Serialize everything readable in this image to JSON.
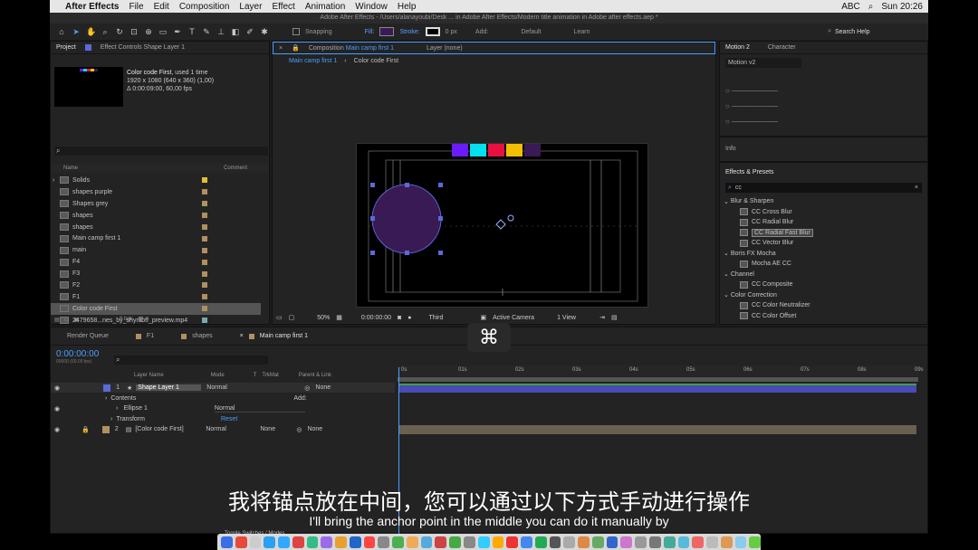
{
  "menubar": {
    "app": "After Effects",
    "items": [
      "File",
      "Edit",
      "Composition",
      "Layer",
      "Effect",
      "Animation",
      "Window",
      "Help"
    ],
    "abc": "ABC",
    "time": "Sun 20:26"
  },
  "titlebar": "Adobe After Effects - /Users/alanayoubi/Desk ... in Adobe After Effects/Modern title animation in Adobe after effects.aep *",
  "toolbar": {
    "snapping": "Snapping",
    "fill": "Fill:",
    "stroke": "Stroke:",
    "stroke_px": "0 px",
    "add": "Add:",
    "workspace1": "Default",
    "workspace2": "Learn",
    "search": "Search Help"
  },
  "project": {
    "tab1": "Project",
    "tab2": "Effect Controls Shape Layer 1",
    "name": "Color code First",
    "used": ", used 1 time",
    "info1": "1920 x 1080  (640 x 360) (1,00)",
    "info2": "Δ 0:00:09:00, 60,00 fps",
    "col_name": "Name",
    "col_comment": "Comment",
    "bpc": "8 bpc",
    "items": [
      {
        "name": "Solids",
        "color": "#e0c030",
        "folder": true
      },
      {
        "name": "shapes purple",
        "color": "#b09060"
      },
      {
        "name": "Shapes grey",
        "color": "#b09060"
      },
      {
        "name": "shapes",
        "color": "#b09060"
      },
      {
        "name": "shapes",
        "color": "#b09060"
      },
      {
        "name": "Main camp first 1",
        "color": "#b09060"
      },
      {
        "name": "main",
        "color": "#b09060"
      },
      {
        "name": "F4",
        "color": "#b09060"
      },
      {
        "name": "F3",
        "color": "#b09060"
      },
      {
        "name": "F2",
        "color": "#b09060"
      },
      {
        "name": "F1",
        "color": "#b09060"
      },
      {
        "name": "Color code First",
        "color": "#b09060",
        "selected": true
      },
      {
        "name": "2479658...nes_by_shymoff_preview.mp4",
        "color": "#7aaab0"
      }
    ]
  },
  "comp": {
    "tab": "Composition",
    "tab_name": "Main camp first 1",
    "layer_tab": "Layer (none)",
    "crumb1": "Main camp first 1",
    "crumb2": "Color code First",
    "zoom": "50%",
    "timecode": "0:00:00:00",
    "res": "Third",
    "camera": "Active Camera",
    "views": "1 View",
    "swatches": [
      "#6a1bff",
      "#00e0ee",
      "#e81040",
      "#f0c000",
      "#3a1a55"
    ]
  },
  "right": {
    "tab1": "Motion 2",
    "tab2": "Character",
    "preset": "Motion v2",
    "info": "Info",
    "effects_title": "Effects & Presets",
    "search": "cc",
    "groups": [
      {
        "name": "Blur & Sharpen",
        "items": [
          "CC Cross Blur",
          "CC Radial Blur",
          "CC Radial Fast Blur",
          "CC Vector Blur"
        ]
      },
      {
        "name": "Boris FX Mocha",
        "items": [
          "Mocha AE CC"
        ]
      },
      {
        "name": "Channel",
        "items": [
          "CC Composite"
        ]
      },
      {
        "name": "Color Correction",
        "items": [
          "CC Color Neutralizer",
          "CC Color Offset"
        ]
      }
    ],
    "selected_effect": "CC Radial Fast Blur"
  },
  "timeline": {
    "tabs": [
      {
        "label": "Render Queue"
      },
      {
        "label": "F1",
        "color": "#b09060"
      },
      {
        "label": "shapes",
        "color": "#b09060"
      },
      {
        "label": "Main camp first 1",
        "color": "#b09060",
        "active": true
      }
    ],
    "timecode": "0:00:00:00",
    "fps": "00000 (60.00 fps)",
    "col_layer": "Layer Name",
    "col_mode": "Mode",
    "col_t": "T",
    "col_trkmat": "TrkMat",
    "col_parent": "Parent & Link",
    "ruler": [
      "0s",
      "01s",
      "02s",
      "03s",
      "04s",
      "05s",
      "06s",
      "07s",
      "08s",
      "09s"
    ],
    "layers": [
      {
        "num": "1",
        "name": "Shape Layer 1",
        "mode": "Normal",
        "parent": "None",
        "color": "#5a6ad8"
      },
      {
        "num": "2",
        "name": "[Color code First]",
        "mode": "Normal",
        "trkmat": "None",
        "parent": "None",
        "color": "#b09060"
      }
    ],
    "contents": "Contents",
    "add": "Add:",
    "ellipse": "Ellipse 1",
    "ellipse_mode": "Normal",
    "transform": "Transform",
    "reset": "Reset",
    "toggle": "Toggle Switches / Modes"
  },
  "subtitle": {
    "zh": "我将锚点放在中间，您可以通过以下方式手动进行操作",
    "en": "I'll bring the anchor point in the middle you can do it manually by"
  },
  "overlay_key": "⌘"
}
